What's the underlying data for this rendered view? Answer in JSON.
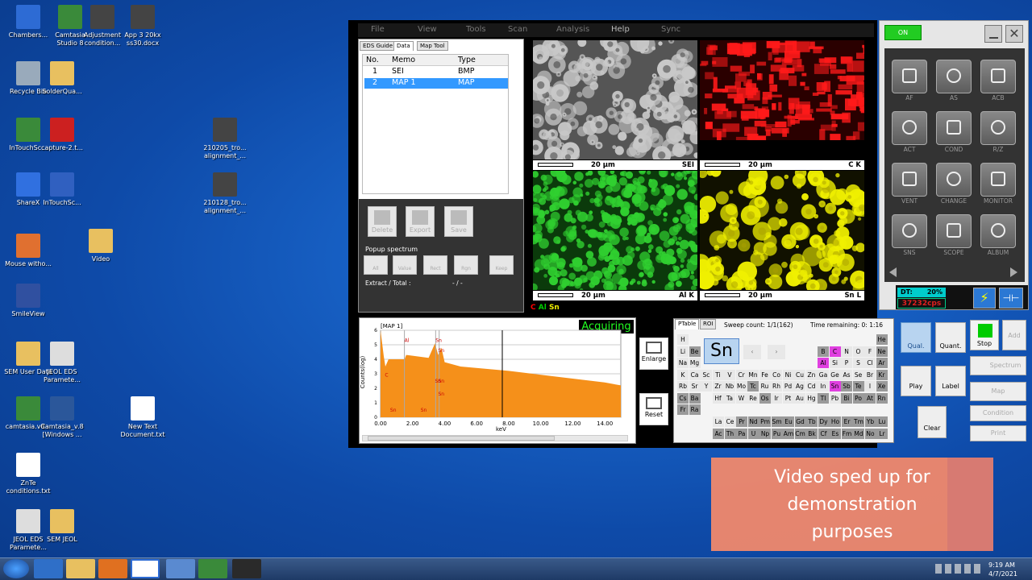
{
  "desktop": {
    "icons": [
      {
        "label": "Chambers...",
        "color": "#2d6bd4"
      },
      {
        "label": "Camtasia Studio 8",
        "color": "#3a8a3a"
      },
      {
        "label": "Adjustment condition...",
        "color": "#444"
      },
      {
        "label": "App 3 20kx ss30.docx",
        "color": "#444"
      },
      {
        "label": "Recycle Bin",
        "color": "#9ab"
      },
      {
        "label": "SolderQua...",
        "color": "#e8c060"
      },
      {
        "label": "InTouchSc...",
        "color": "#3a8a3a"
      },
      {
        "label": "capture-2.t...",
        "color": "#cc2020"
      },
      {
        "label": "210205_tro... alignment_...",
        "color": "#444"
      },
      {
        "label": "ShareX",
        "color": "#3070e0"
      },
      {
        "label": "InTouchSc...",
        "color": "#3060c0"
      },
      {
        "label": "210128_tro... alignment_...",
        "color": "#444"
      },
      {
        "label": "Mouse witho...",
        "color": "#e07030"
      },
      {
        "label": "Video",
        "color": "#e8c060"
      },
      {
        "label": "SmileView",
        "color": "#3050a0"
      },
      {
        "label": "SEM User Data",
        "color": "#e8c060"
      },
      {
        "label": "JEOL EDS Paramete...",
        "color": "#ddd"
      },
      {
        "label": "camtasia.v8...",
        "color": "#3a8a3a"
      },
      {
        "label": "Camtasia_v.8 [Windows ...",
        "color": "#2b579a"
      },
      {
        "label": "New Text Document.txt",
        "color": "#fff"
      },
      {
        "label": "ZnTe conditions.txt",
        "color": "#fff"
      },
      {
        "label": "JEOL EDS Paramete...",
        "color": "#ddd"
      },
      {
        "label": "SEM JEOL",
        "color": "#e8c060"
      }
    ]
  },
  "menu": {
    "items": [
      "File",
      "View",
      "Tools",
      "Scan",
      "Analysis",
      "Help",
      "Sync"
    ]
  },
  "left_panel": {
    "tabs": [
      "EDS Guide",
      "Data",
      "Map Tool"
    ],
    "table": {
      "headers": [
        "No.",
        "Memo",
        "Type"
      ],
      "rows": [
        {
          "no": "1",
          "memo": "SEI",
          "type": "BMP"
        },
        {
          "no": "2",
          "memo": "MAP 1",
          "type": "MAP"
        }
      ]
    },
    "buttons": [
      "Delete",
      "Export",
      "Save"
    ],
    "popup_label": "Popup spectrum",
    "popup_buttons": [
      "All",
      "Value",
      "Rect",
      "Rgn",
      "Keep"
    ],
    "extract_label": "Extract / Total :",
    "extract_value": "- / -"
  },
  "maps": [
    {
      "label": "SEI",
      "scale": "20 µm"
    },
    {
      "label": "C K",
      "scale": "20 µm"
    },
    {
      "label": "Al K",
      "scale": "20 µm"
    },
    {
      "label": "Sn L",
      "scale": "20 µm"
    }
  ],
  "map_legend": {
    "c": "C",
    "al": "Al",
    "sn": "Sn"
  },
  "right_panel": {
    "on_label": "ON",
    "buttons": [
      "AF",
      "AS",
      "ACB",
      "ACT",
      "COND",
      "R/Z",
      "VENT",
      "CHANGE",
      "MONITOR",
      "SNS",
      "SCOPE",
      "ALBUM"
    ],
    "dt_label": "DT:",
    "dt_value": "20%",
    "cps_value": "37232cps"
  },
  "spectrum": {
    "title": "[MAP 1]",
    "status": "Acquiring",
    "ylabel": "Counts(log)",
    "xlabel": "keV",
    "yticks": [
      "6",
      "5",
      "4",
      "3",
      "2",
      "1",
      "0"
    ],
    "xticks": [
      "0.00",
      "2.00",
      "4.00",
      "6.00",
      "8.00",
      "10.00",
      "12.00",
      "14.00"
    ],
    "peak_labels": [
      "C",
      "Al",
      "Sn",
      "Sn",
      "Sn",
      "Sn",
      "Sn",
      "Sn",
      "Sn"
    ],
    "enlarge": "Enlarge",
    "reset": "Reset"
  },
  "ptable": {
    "tabs": [
      "PTable",
      "ROI"
    ],
    "sweep": "Sweep count: 1/1(162)",
    "remaining": "Time remaining:  0: 1:16",
    "selected": "Sn",
    "rows": [
      [
        "H",
        "",
        "",
        "",
        "",
        "",
        "",
        "",
        "",
        "",
        "",
        "",
        "",
        "",
        "",
        "",
        "",
        "He"
      ],
      [
        "Li",
        "Be",
        "",
        "",
        "",
        "",
        "",
        "",
        "",
        "",
        "",
        "",
        "B",
        "C",
        "N",
        "O",
        "F",
        "Ne"
      ],
      [
        "Na",
        "Mg",
        "",
        "",
        "",
        "",
        "",
        "",
        "",
        "",
        "",
        "",
        "Al",
        "Si",
        "P",
        "S",
        "Cl",
        "Ar"
      ],
      [
        "K",
        "Ca",
        "Sc",
        "Ti",
        "V",
        "Cr",
        "Mn",
        "Fe",
        "Co",
        "Ni",
        "Cu",
        "Zn",
        "Ga",
        "Ge",
        "As",
        "Se",
        "Br",
        "Kr"
      ],
      [
        "Rb",
        "Sr",
        "Y",
        "Zr",
        "Nb",
        "Mo",
        "Tc",
        "Ru",
        "Rh",
        "Pd",
        "Ag",
        "Cd",
        "In",
        "Sn",
        "Sb",
        "Te",
        "I",
        "Xe"
      ],
      [
        "Cs",
        "Ba",
        "",
        "Hf",
        "Ta",
        "W",
        "Re",
        "Os",
        "Ir",
        "Pt",
        "Au",
        "Hg",
        "Tl",
        "Pb",
        "Bi",
        "Po",
        "At",
        "Rn"
      ],
      [
        "Fr",
        "Ra",
        "",
        "",
        "",
        "",
        "",
        "",
        "",
        "",
        "",
        "",
        "",
        "",
        "",
        "",
        "",
        ""
      ]
    ],
    "lanth": [
      "La",
      "Ce",
      "Pr",
      "Nd",
      "Pm",
      "Sm",
      "Eu",
      "Gd",
      "Tb",
      "Dy",
      "Ho",
      "Er",
      "Tm",
      "Yb",
      "Lu"
    ],
    "actin": [
      "Ac",
      "Th",
      "Pa",
      "U",
      "Np",
      "Pu",
      "Am",
      "Cm",
      "Bk",
      "Cf",
      "Es",
      "Fm",
      "Md",
      "No",
      "Lr"
    ]
  },
  "controls": {
    "qual": "Qual.",
    "quant": "Quant.",
    "stop": "Stop",
    "add": "Add",
    "play": "Play",
    "label": "Label",
    "spectrum": "Spectrum",
    "map": "Map",
    "condition": "Condition",
    "clear": "Clear",
    "print": "Print"
  },
  "overlay": {
    "text_lines": [
      "Video sped up for",
      "demonstration",
      "purposes"
    ]
  },
  "taskbar": {
    "time": "9:19 AM",
    "date": "4/7/2021"
  }
}
